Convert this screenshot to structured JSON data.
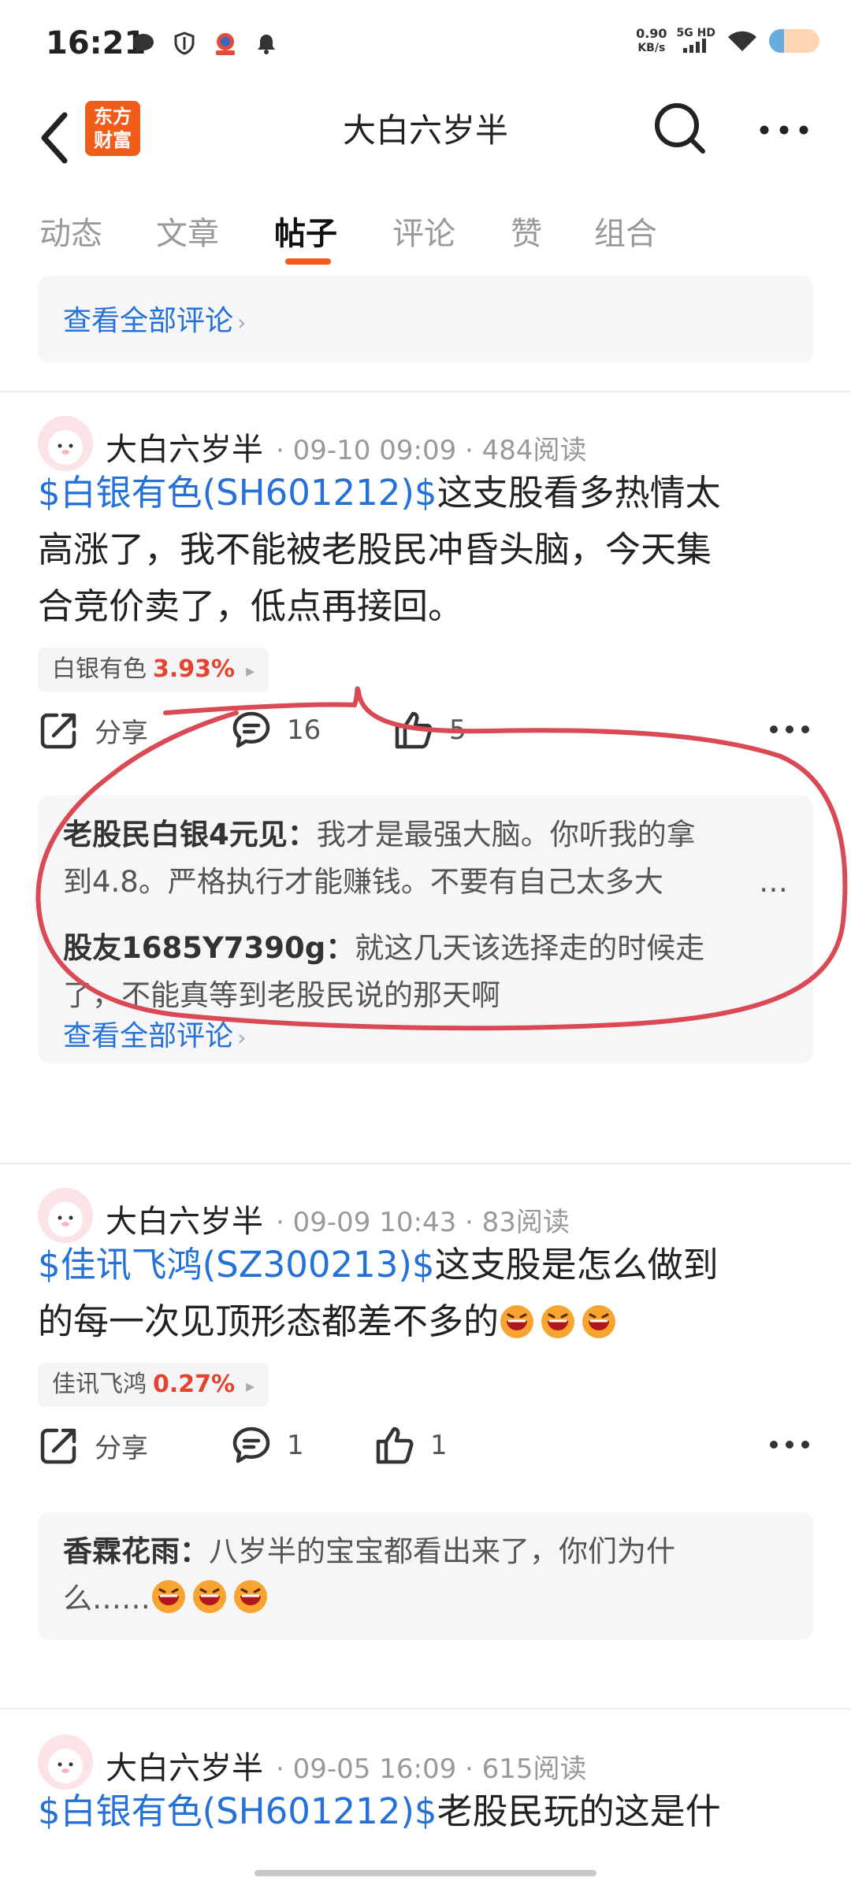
{
  "status_bar": {
    "time": "16:21",
    "speed_value": "0.90",
    "speed_unit": "KB/s",
    "network": "5G HD",
    "battery_level": 0.3
  },
  "nav": {
    "logo_line1": "东方",
    "logo_line2": "财富",
    "title": "大白六岁半"
  },
  "tabs": [
    {
      "label": "动态"
    },
    {
      "label": "文章"
    },
    {
      "label": "帖子",
      "active": true
    },
    {
      "label": "评论"
    },
    {
      "label": "赞"
    },
    {
      "label": "组合"
    }
  ],
  "top_card": {
    "view_all": "查看全部评论"
  },
  "posts": [
    {
      "author": "大白六岁半",
      "meta": "· 09-10 09:09 · 484阅读",
      "stock_link": "$白银有色(SH601212)$",
      "text_line1": "这支股看多热情太",
      "text_line2": "高涨了，我不能被老股民冲昏头脑，今天集",
      "text_line3": "合竞价卖了，低点再接回。",
      "chip_name": "白银有色",
      "chip_pct": "3.93%",
      "share_label": "分享",
      "comment_count": "16",
      "like_count": "5",
      "comments": [
        {
          "user": "老股民白银4元见：",
          "line1": "我才是最强大脑。你听我的拿",
          "line2": "到4.8。严格执行才能赚钱。不要有自己太多大"
        },
        {
          "user": "股友1685Y7390g：",
          "line1": "就这几天该选择走的时候走",
          "line2": "了，不能真等到老股民说的那天啊"
        }
      ],
      "view_all": "查看全部评论"
    },
    {
      "author": "大白六岁半",
      "meta": "· 09-09 10:43 · 83阅读",
      "stock_link": "$佳讯飞鸿(SZ300213)$",
      "text_line1": "这支股是怎么做到",
      "text_line2": "的每一次见顶形态都差不多的",
      "chip_name": "佳讯飞鸿",
      "chip_pct": "0.27%",
      "share_label": "分享",
      "comment_count": "1",
      "like_count": "1",
      "comments": [
        {
          "user": "香霖花雨：",
          "line1": "八岁半的宝宝都看出来了，你们为什",
          "line2": "么……"
        }
      ]
    },
    {
      "author": "大白六岁半",
      "meta": "· 09-05 16:09 · 615阅读",
      "stock_link": "$白银有色(SH601212)$",
      "text_line1": "老股民玩的这是什"
    }
  ],
  "colors": {
    "accent": "#f25c1a",
    "link": "#2471d8",
    "rise": "#e2442f",
    "annotation": "#d94a55"
  }
}
